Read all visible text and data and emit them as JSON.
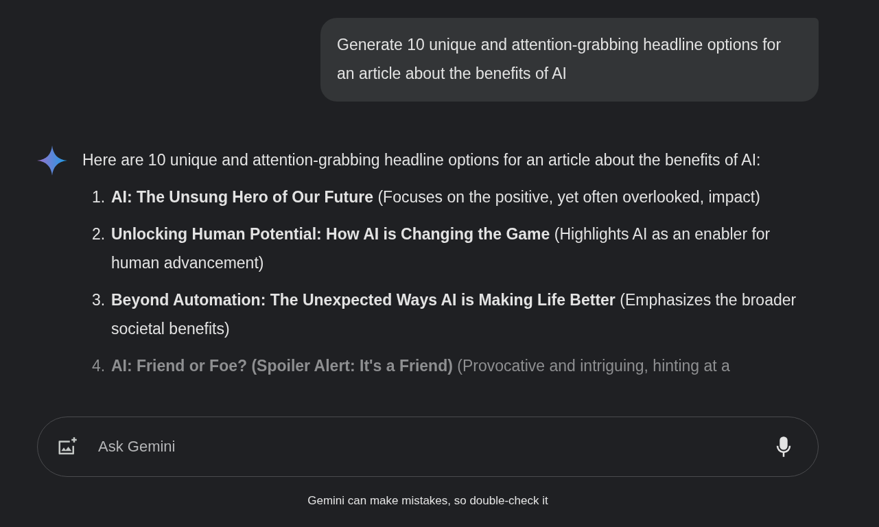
{
  "user_message": "Generate 10 unique and attention-grabbing headline options for an article about the benefits of AI",
  "response": {
    "intro": "Here are 10 unique and attention-grabbing headline options for an article about the benefits of AI:",
    "items": [
      {
        "number": "1.",
        "text": "**AI: The Unsung Hero of Our Future** (Focuses on the positive, yet often overlooked, impact)",
        "faded": false
      },
      {
        "number": "2.",
        "text": "**Unlocking Human Potential: How AI is Changing the Game** (Highlights AI as an enabler for human advancement)",
        "faded": false
      },
      {
        "number": "3.",
        "text": "**Beyond Automation: The Unexpected Ways AI is Making Life Better** (Emphasizes the broader societal benefits)",
        "faded": false
      },
      {
        "number": "4.",
        "text": "**AI: Friend or Foe? (Spoiler Alert: It's a Friend)** (Provocative and intriguing, hinting at a",
        "faded": true
      }
    ]
  },
  "input": {
    "placeholder": "Ask Gemini"
  },
  "disclaimer": "Gemini can make mistakes, so double-check it"
}
